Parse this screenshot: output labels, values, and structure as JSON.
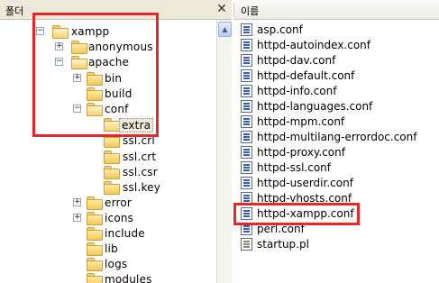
{
  "folder_pane": {
    "title": "폴더",
    "close_glyph": "✕",
    "scroll_up_glyph": "▲",
    "tree": [
      {
        "label": "xampp",
        "expander": "−"
      },
      {
        "label": "anonymous",
        "expander": "+"
      },
      {
        "label": "apache",
        "expander": "−"
      },
      {
        "label": "bin",
        "expander": "+"
      },
      {
        "label": "build",
        "expander": ""
      },
      {
        "label": "conf",
        "expander": "−"
      },
      {
        "label": "extra",
        "expander": "",
        "selected": true
      },
      {
        "label": "ssl.crl",
        "expander": ""
      },
      {
        "label": "ssl.crt",
        "expander": ""
      },
      {
        "label": "ssl.csr",
        "expander": ""
      },
      {
        "label": "ssl.key",
        "expander": ""
      },
      {
        "label": "error",
        "expander": "+"
      },
      {
        "label": "icons",
        "expander": "+"
      },
      {
        "label": "include",
        "expander": ""
      },
      {
        "label": "lib",
        "expander": ""
      },
      {
        "label": "logs",
        "expander": ""
      },
      {
        "label": "modules",
        "expander": ""
      }
    ]
  },
  "file_pane": {
    "column_name": "이름",
    "files": [
      {
        "name": "asp.conf"
      },
      {
        "name": "httpd-autoindex.conf"
      },
      {
        "name": "httpd-dav.conf"
      },
      {
        "name": "httpd-default.conf"
      },
      {
        "name": "httpd-info.conf"
      },
      {
        "name": "httpd-languages.conf"
      },
      {
        "name": "httpd-mpm.conf"
      },
      {
        "name": "httpd-multilang-errordoc.conf"
      },
      {
        "name": "httpd-proxy.conf"
      },
      {
        "name": "httpd-ssl.conf"
      },
      {
        "name": "httpd-userdir.conf"
      },
      {
        "name": "httpd-vhosts.conf"
      },
      {
        "name": "httpd-xampp.conf"
      },
      {
        "name": "perl.conf"
      },
      {
        "name": "startup.pl"
      }
    ]
  },
  "colors": {
    "highlight": "#e8262a",
    "header_bg": "#ece9d8"
  }
}
